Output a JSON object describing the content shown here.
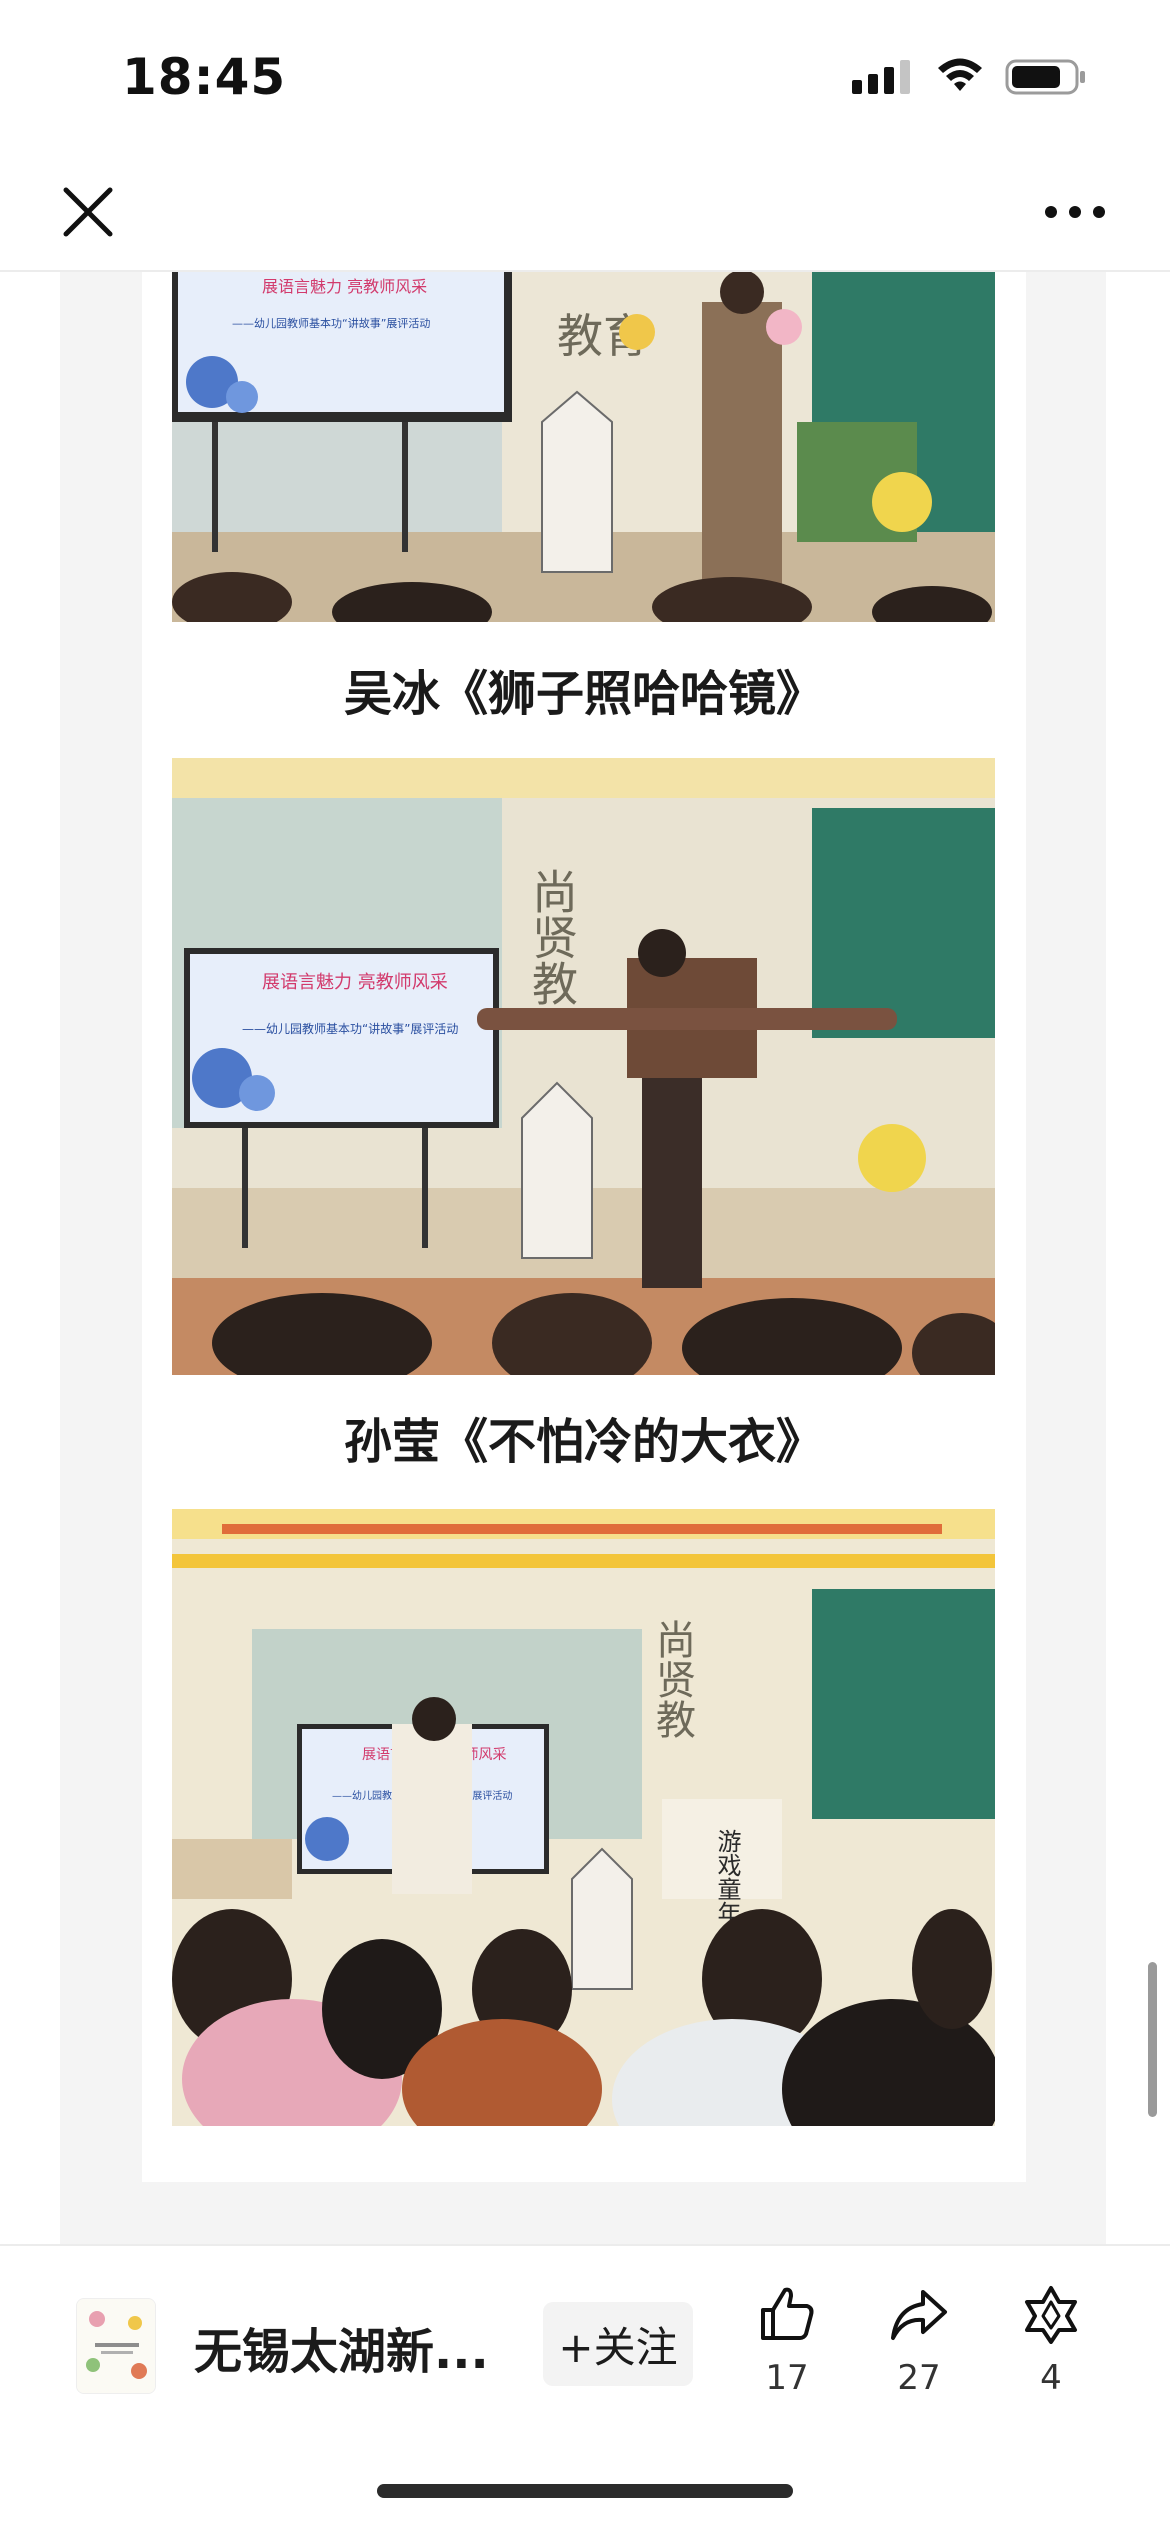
{
  "status_bar": {
    "time": "18:45",
    "icons": [
      "cellular-signal-icon",
      "wifi-icon",
      "battery-icon"
    ]
  },
  "nav": {
    "icons": [
      "close-icon",
      "more-icon"
    ]
  },
  "article": {
    "photo1": {
      "screen_title": "展语言魅力 亮教师风采",
      "screen_subtitle": "——幼儿园教师基本功“讲故事”展评活动",
      "wall_text": "教育"
    },
    "caption1": "吴冰《狮子照哈哈镜》",
    "photo2": {
      "screen_title": "展语言魅力 亮教师风采",
      "screen_subtitle": "——幼儿园教师基本功“讲故事”展评活动",
      "wall_text": "尚贤教"
    },
    "caption2": "孙莹《不怕冷的大衣》",
    "photo3": {
      "screen_title": "展语言魅力 亮教师风采",
      "screen_subtitle": "——幼儿园教师基本功“讲故事”展评活动",
      "wall_text": "尚贤教",
      "sign_text": "游戏童年"
    }
  },
  "bottom_bar": {
    "account_name": "无锡太湖新...",
    "follow_label": "+关注",
    "like_count": "17",
    "share_count": "27",
    "wow_count": "4",
    "icons": [
      "thumbs-up-icon",
      "share-arrow-icon",
      "wow-star-icon"
    ]
  },
  "colors": {
    "background": "#ffffff",
    "page_bg": "#f4f4f4",
    "follow_bg": "#f3f3f3",
    "text": "#1b1b1b"
  }
}
